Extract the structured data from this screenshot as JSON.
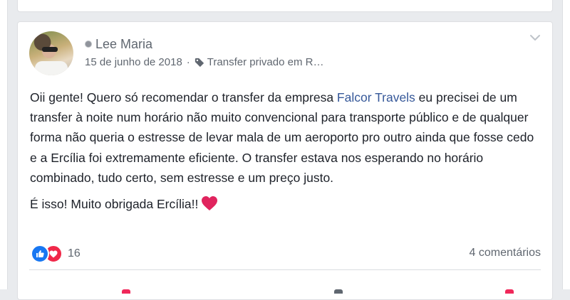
{
  "post": {
    "author": "Lee Maria",
    "date": "15 de junho de 2018",
    "separator": "·",
    "tag_text": "Transfer privado em R…",
    "body_part1": "Oii gente! Quero só recomendar o transfer da empresa ",
    "page_link": "Falcor Travels",
    "body_part2": " eu precisei de um transfer à noite num horário não muito convencional para transporte público e de qualquer forma não queria o estresse de levar mala de um aeroporto pro outro ainda que fosse cedo e a Ercília foi extremamente eficiente. O transfer estava nos esperando no horário combinado, tudo certo, sem estresse e um preço justo.",
    "closing": "É isso! Muito obrigada Ercília!!",
    "closing_emoji": "heart-emoji"
  },
  "reactions": {
    "count": "16",
    "icons": [
      "like-icon",
      "love-icon"
    ]
  },
  "comments": {
    "label": "4 comentários"
  },
  "colors": {
    "link": "#365899",
    "like": "#1877f2",
    "love": "#f02849",
    "heart": "#e0245e",
    "meta": "#606770"
  }
}
